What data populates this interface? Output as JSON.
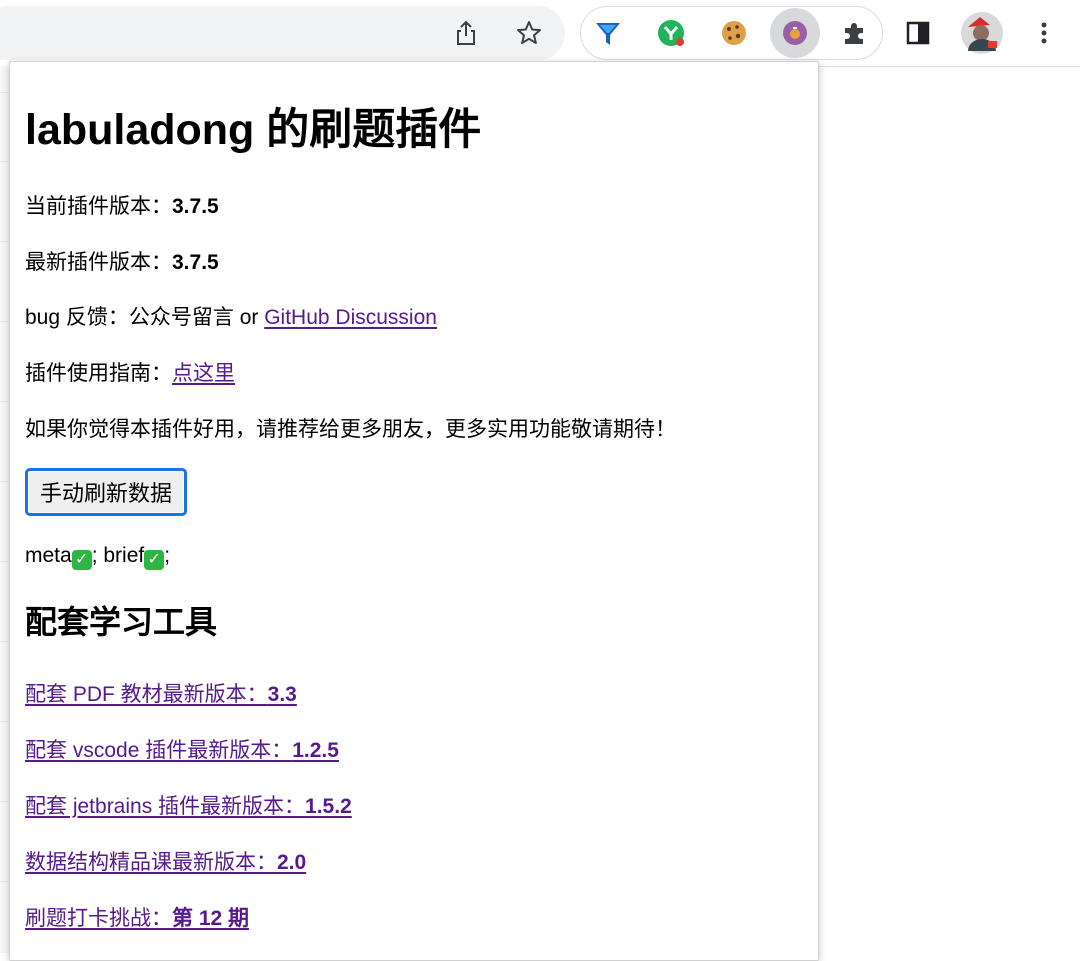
{
  "toolbar": {
    "icons": [
      "share-icon",
      "bookmark-star-icon",
      "funnel-extension-icon",
      "y-extension-icon",
      "cookie-extension-icon",
      "leetcode-extension-icon",
      "extensions-puzzle-icon",
      "side-panel-icon",
      "profile-avatar",
      "menu-kebab-icon"
    ]
  },
  "popup": {
    "title": "labuladong 的刷题插件",
    "current_version_label": "当前插件版本：",
    "current_version": "3.7.5",
    "latest_version_label": "最新插件版本：",
    "latest_version": "3.7.5",
    "bug_feedback_label": "bug 反馈：公众号留言 or ",
    "bug_feedback_link": "GitHub Discussion",
    "guide_label": "插件使用指南：",
    "guide_link": "点这里",
    "recommend_text": "如果你觉得本插件好用，请推荐给更多朋友，更多实用功能敬请期待！",
    "refresh_button": "手动刷新数据",
    "status": {
      "meta_label": "meta",
      "sep1": "; brief",
      "sep2": ";",
      "check_icon": "✓"
    },
    "tools_heading": "配套学习工具",
    "tools": [
      {
        "label": "配套 PDF 教材最新版本：",
        "value": "3.3"
      },
      {
        "label": "配套 vscode 插件最新版本：",
        "value": "1.2.5"
      },
      {
        "label": "配套 jetbrains 插件最新版本：",
        "value": "1.5.2"
      },
      {
        "label": "数据结构精品课最新版本：",
        "value": "2.0"
      },
      {
        "label": "刷题打卡挑战：",
        "value": "第 12 期"
      }
    ]
  },
  "colors": {
    "link": "#551a8b",
    "button_focus": "#1a73e8",
    "check": "#2db742"
  }
}
